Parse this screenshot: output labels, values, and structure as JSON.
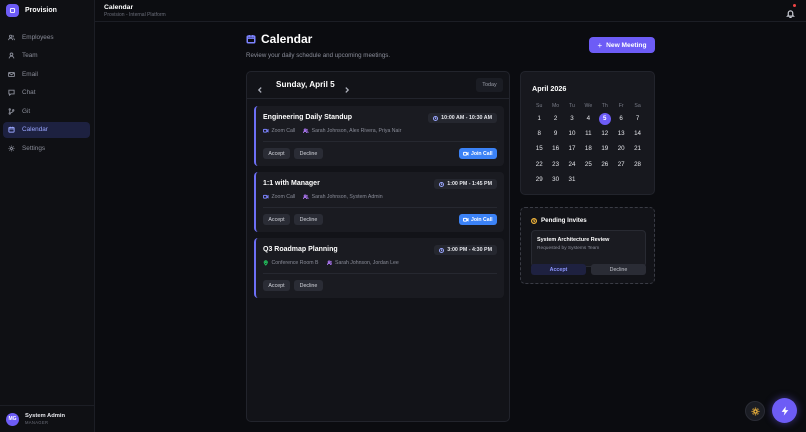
{
  "app": {
    "brand": "Provision"
  },
  "sidebar": {
    "items": [
      {
        "label": "Employees",
        "icon": "users-icon"
      },
      {
        "label": "Team",
        "icon": "person-icon"
      },
      {
        "label": "Email",
        "icon": "mail-icon"
      },
      {
        "label": "Chat",
        "icon": "chat-icon"
      },
      {
        "label": "Git",
        "icon": "git-branch-icon"
      },
      {
        "label": "Calendar",
        "icon": "calendar-icon",
        "active": true
      },
      {
        "label": "Settings",
        "icon": "gear-icon"
      }
    ],
    "user": {
      "initials": "MG",
      "name": "System Admin",
      "role": "MANAGER"
    }
  },
  "topbar": {
    "title": "Calendar",
    "subtitle": "Provision - Internal Platform"
  },
  "page": {
    "title": "Calendar",
    "description": "Review your daily schedule and upcoming meetings.",
    "new_button": "New Meeting"
  },
  "schedule": {
    "date": "Sunday, April 5",
    "today_label": "Today",
    "events": [
      {
        "title": "Engineering Daily Standup",
        "time": "10:00 AM - 10:30 AM",
        "location": "Zoom Call",
        "location_type": "video",
        "attendees": "Sarah Johnson, Alex Rivera, Priya Nair",
        "accept": "Accept",
        "decline": "Decline",
        "join": "Join Call"
      },
      {
        "title": "1:1 with Manager",
        "time": "1:00 PM - 1:45 PM",
        "location": "Zoom Call",
        "location_type": "video",
        "attendees": "Sarah Johnson, System Admin",
        "accept": "Accept",
        "decline": "Decline",
        "join": "Join Call"
      },
      {
        "title": "Q3 Roadmap Planning",
        "time": "3:00 PM - 4:30 PM",
        "location": "Conference Room B",
        "location_type": "room",
        "attendees": "Sarah Johnson, Jordan Lee",
        "accept": "Accept",
        "decline": "Decline"
      }
    ]
  },
  "mini_calendar": {
    "month": "April 2026",
    "weekdays": [
      "Su",
      "Mo",
      "Tu",
      "We",
      "Th",
      "Fr",
      "Sa"
    ],
    "weeks": [
      [
        "1",
        "2",
        "3",
        "4",
        "5",
        "6",
        "7"
      ],
      [
        "8",
        "9",
        "10",
        "11",
        "12",
        "13",
        "14"
      ],
      [
        "15",
        "16",
        "17",
        "18",
        "19",
        "20",
        "21"
      ],
      [
        "22",
        "23",
        "24",
        "25",
        "26",
        "27",
        "28"
      ],
      [
        "29",
        "30",
        "31",
        "",
        "",
        "",
        ""
      ]
    ],
    "selected": "5"
  },
  "invites": {
    "title": "Pending Invites",
    "items": [
      {
        "title": "System Architecture Review",
        "requested_by": "Requested by Systems Team",
        "accept": "Accept",
        "decline": "Decline"
      }
    ]
  },
  "colors": {
    "accent": "#6d5cf6",
    "join": "#3b82f6",
    "background": "#0b0c10"
  }
}
